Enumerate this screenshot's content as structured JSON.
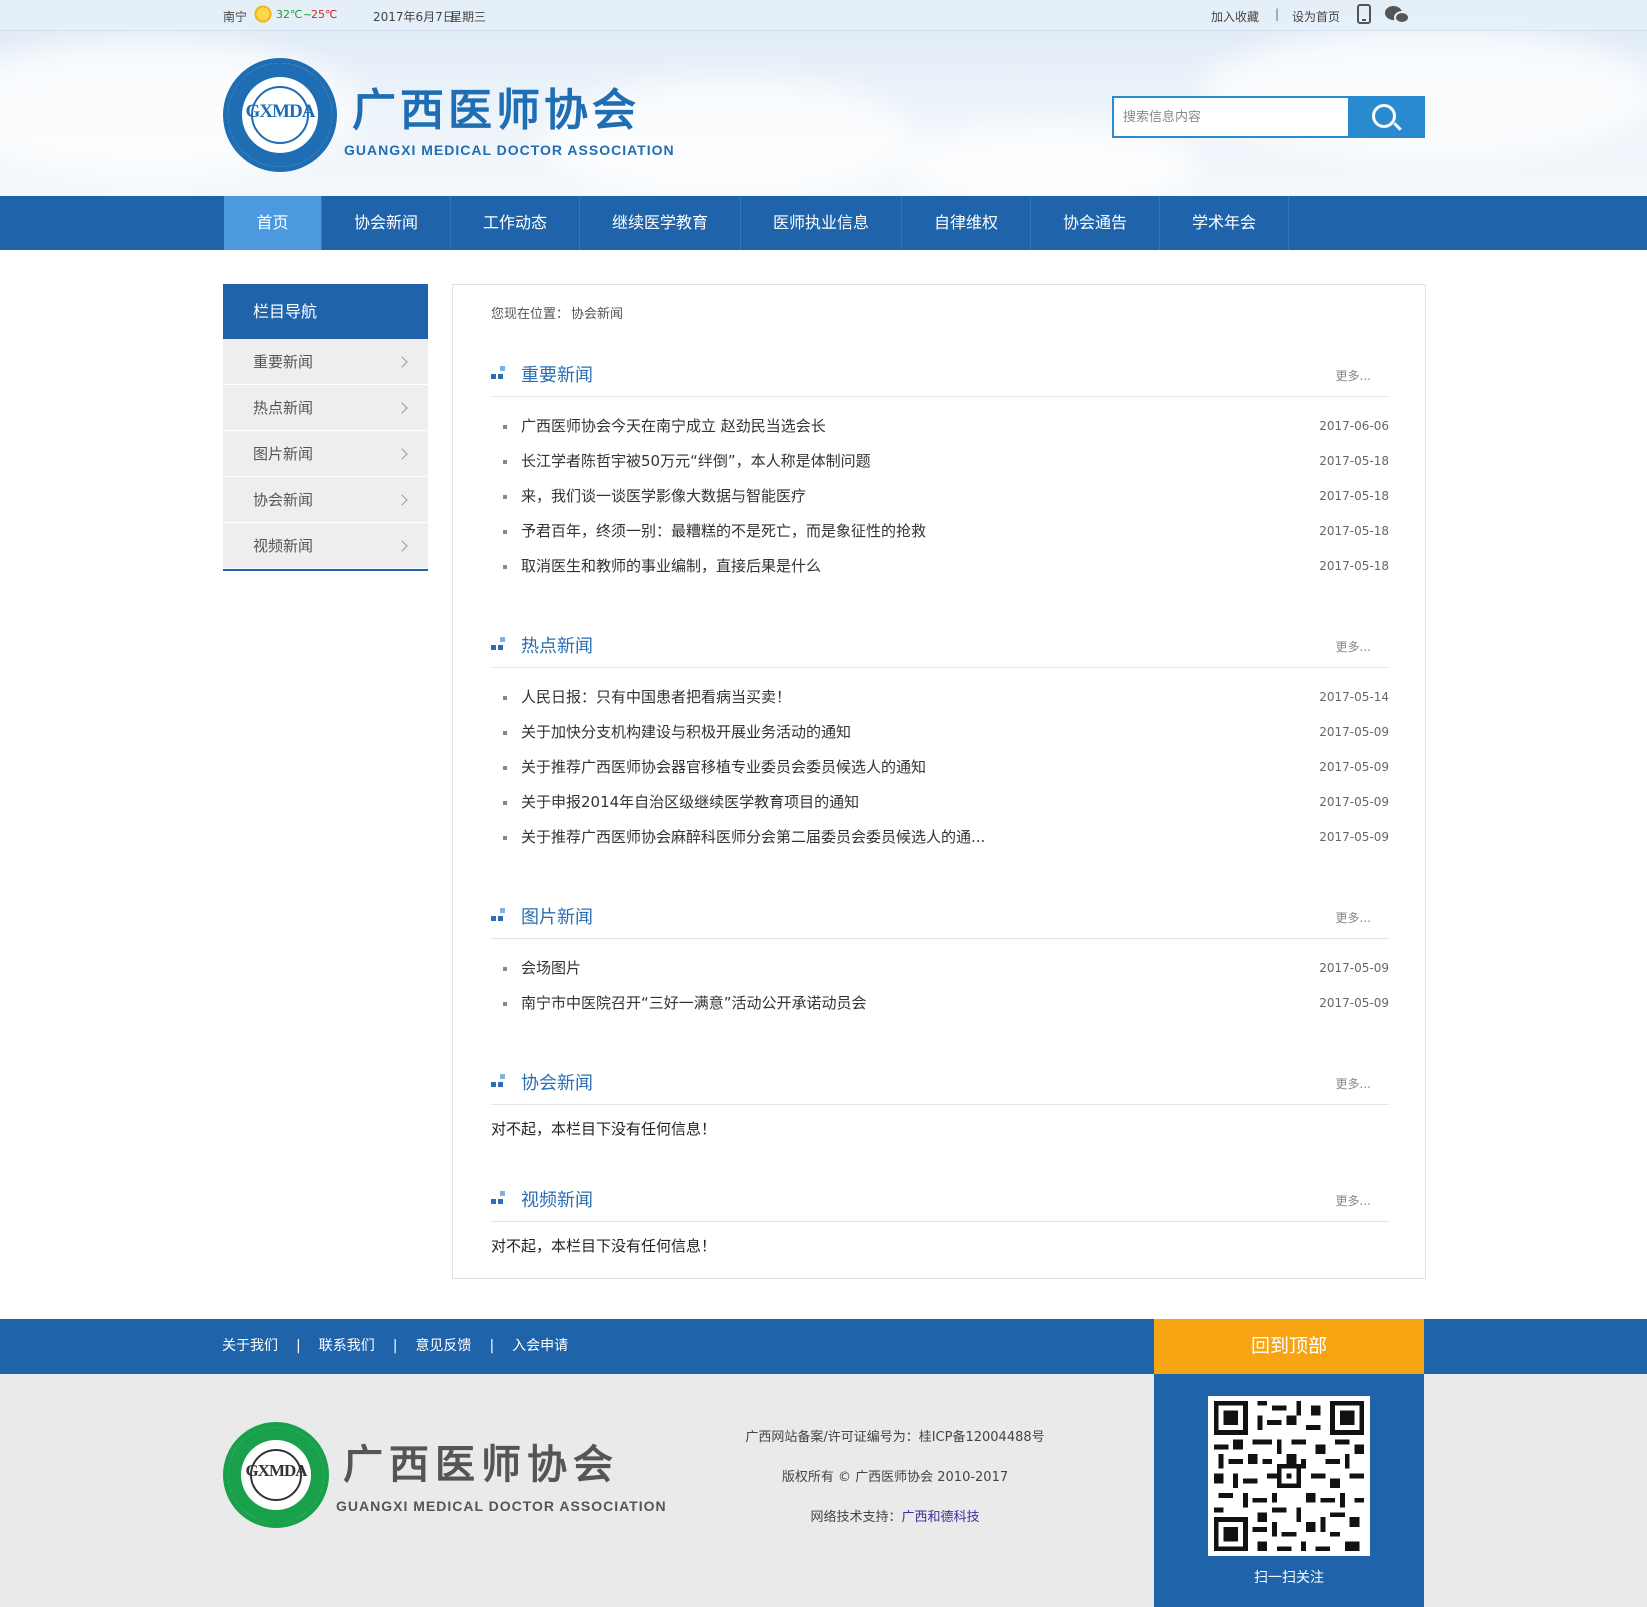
{
  "topbar": {
    "city": "南宁",
    "temp_high": "32℃",
    "temp_sep": "~",
    "temp_low": "25℃",
    "date": "2017年6月7日",
    "weekday": "星期三",
    "add_favorite": "加入收藏",
    "divider": "|",
    "set_homepage": "设为首页",
    "icons": [
      "weather-sunny-icon",
      "mobile-phone-icon",
      "wechat-icon"
    ]
  },
  "header": {
    "logo_abbr": "GXMDA",
    "logo_title": "广西医师协会",
    "logo_subtitle": "GUANGXI MEDICAL DOCTOR ASSOCIATION",
    "search_placeholder": "搜索信息内容"
  },
  "nav": {
    "items": [
      "首页",
      "协会新闻",
      "工作动态",
      "继续医学教育",
      "医师执业信息",
      "自律维权",
      "协会通告",
      "学术年会"
    ],
    "active_index": 0
  },
  "sidebar": {
    "heading": "栏目导航",
    "items": [
      "重要新闻",
      "热点新闻",
      "图片新闻",
      "协会新闻",
      "视频新闻"
    ]
  },
  "breadcrumb": {
    "prefix": "您现在位置：",
    "current": "协会新闻"
  },
  "more_label": "更多...",
  "empty_message": "对不起，本栏目下没有任何信息！",
  "sections": [
    {
      "title": "重要新闻",
      "items": [
        {
          "title": "广西医师协会今天在南宁成立 赵劲民当选会长",
          "date": "2017-06-06"
        },
        {
          "title": "长江学者陈哲宇被50万元“绊倒”，本人称是体制问题",
          "date": "2017-05-18"
        },
        {
          "title": "来，我们谈一谈医学影像大数据与智能医疗",
          "date": "2017-05-18"
        },
        {
          "title": "予君百年，终须一别：最糟糕的不是死亡，而是象征性的抢救",
          "date": "2017-05-18"
        },
        {
          "title": "取消医生和教师的事业编制，直接后果是什么",
          "date": "2017-05-18"
        }
      ]
    },
    {
      "title": "热点新闻",
      "items": [
        {
          "title": "人民日报：只有中国患者把看病当买卖！",
          "date": "2017-05-14"
        },
        {
          "title": "关于加快分支机构建设与积极开展业务活动的通知",
          "date": "2017-05-09"
        },
        {
          "title": "关于推荐广西医师协会器官移植专业委员会委员候选人的通知",
          "date": "2017-05-09"
        },
        {
          "title": "关于申报2014年自治区级继续医学教育项目的通知",
          "date": "2017-05-09"
        },
        {
          "title": "关于推荐广西医师协会麻醉科医师分会第二届委员会委员候选人的通...",
          "date": "2017-05-09"
        }
      ]
    },
    {
      "title": "图片新闻",
      "items": [
        {
          "title": "会场图片",
          "date": "2017-05-09"
        },
        {
          "title": "南宁市中医院召开“三好一满意”活动公开承诺动员会",
          "date": "2017-05-09"
        }
      ]
    },
    {
      "title": "协会新闻",
      "items": []
    },
    {
      "title": "视频新闻",
      "items": []
    }
  ],
  "footer": {
    "links": [
      "关于我们",
      "联系我们",
      "意见反馈",
      "入会申请"
    ],
    "link_separator": "|",
    "back_to_top": "回到顶部",
    "logo_abbr": "GXMDA",
    "logo_title": "广西医师协会",
    "logo_subtitle": "GUANGXI MEDICAL DOCTOR ASSOCIATION",
    "icp": "广西网站备案/许可证编号为：桂ICP备12004488号",
    "copyright": "版权所有 © 广西医师协会 2010-2017",
    "support_prefix": "网络技术支持：",
    "support_name": "广西和德科技",
    "qr_caption": "扫一扫关注"
  },
  "colors": {
    "brand_blue": "#1f64ab",
    "nav_active": "#4d99e0",
    "back_to_top": "#f7a413",
    "section_title": "#2a6fb5",
    "footer_logo_green": "#18a04a"
  }
}
